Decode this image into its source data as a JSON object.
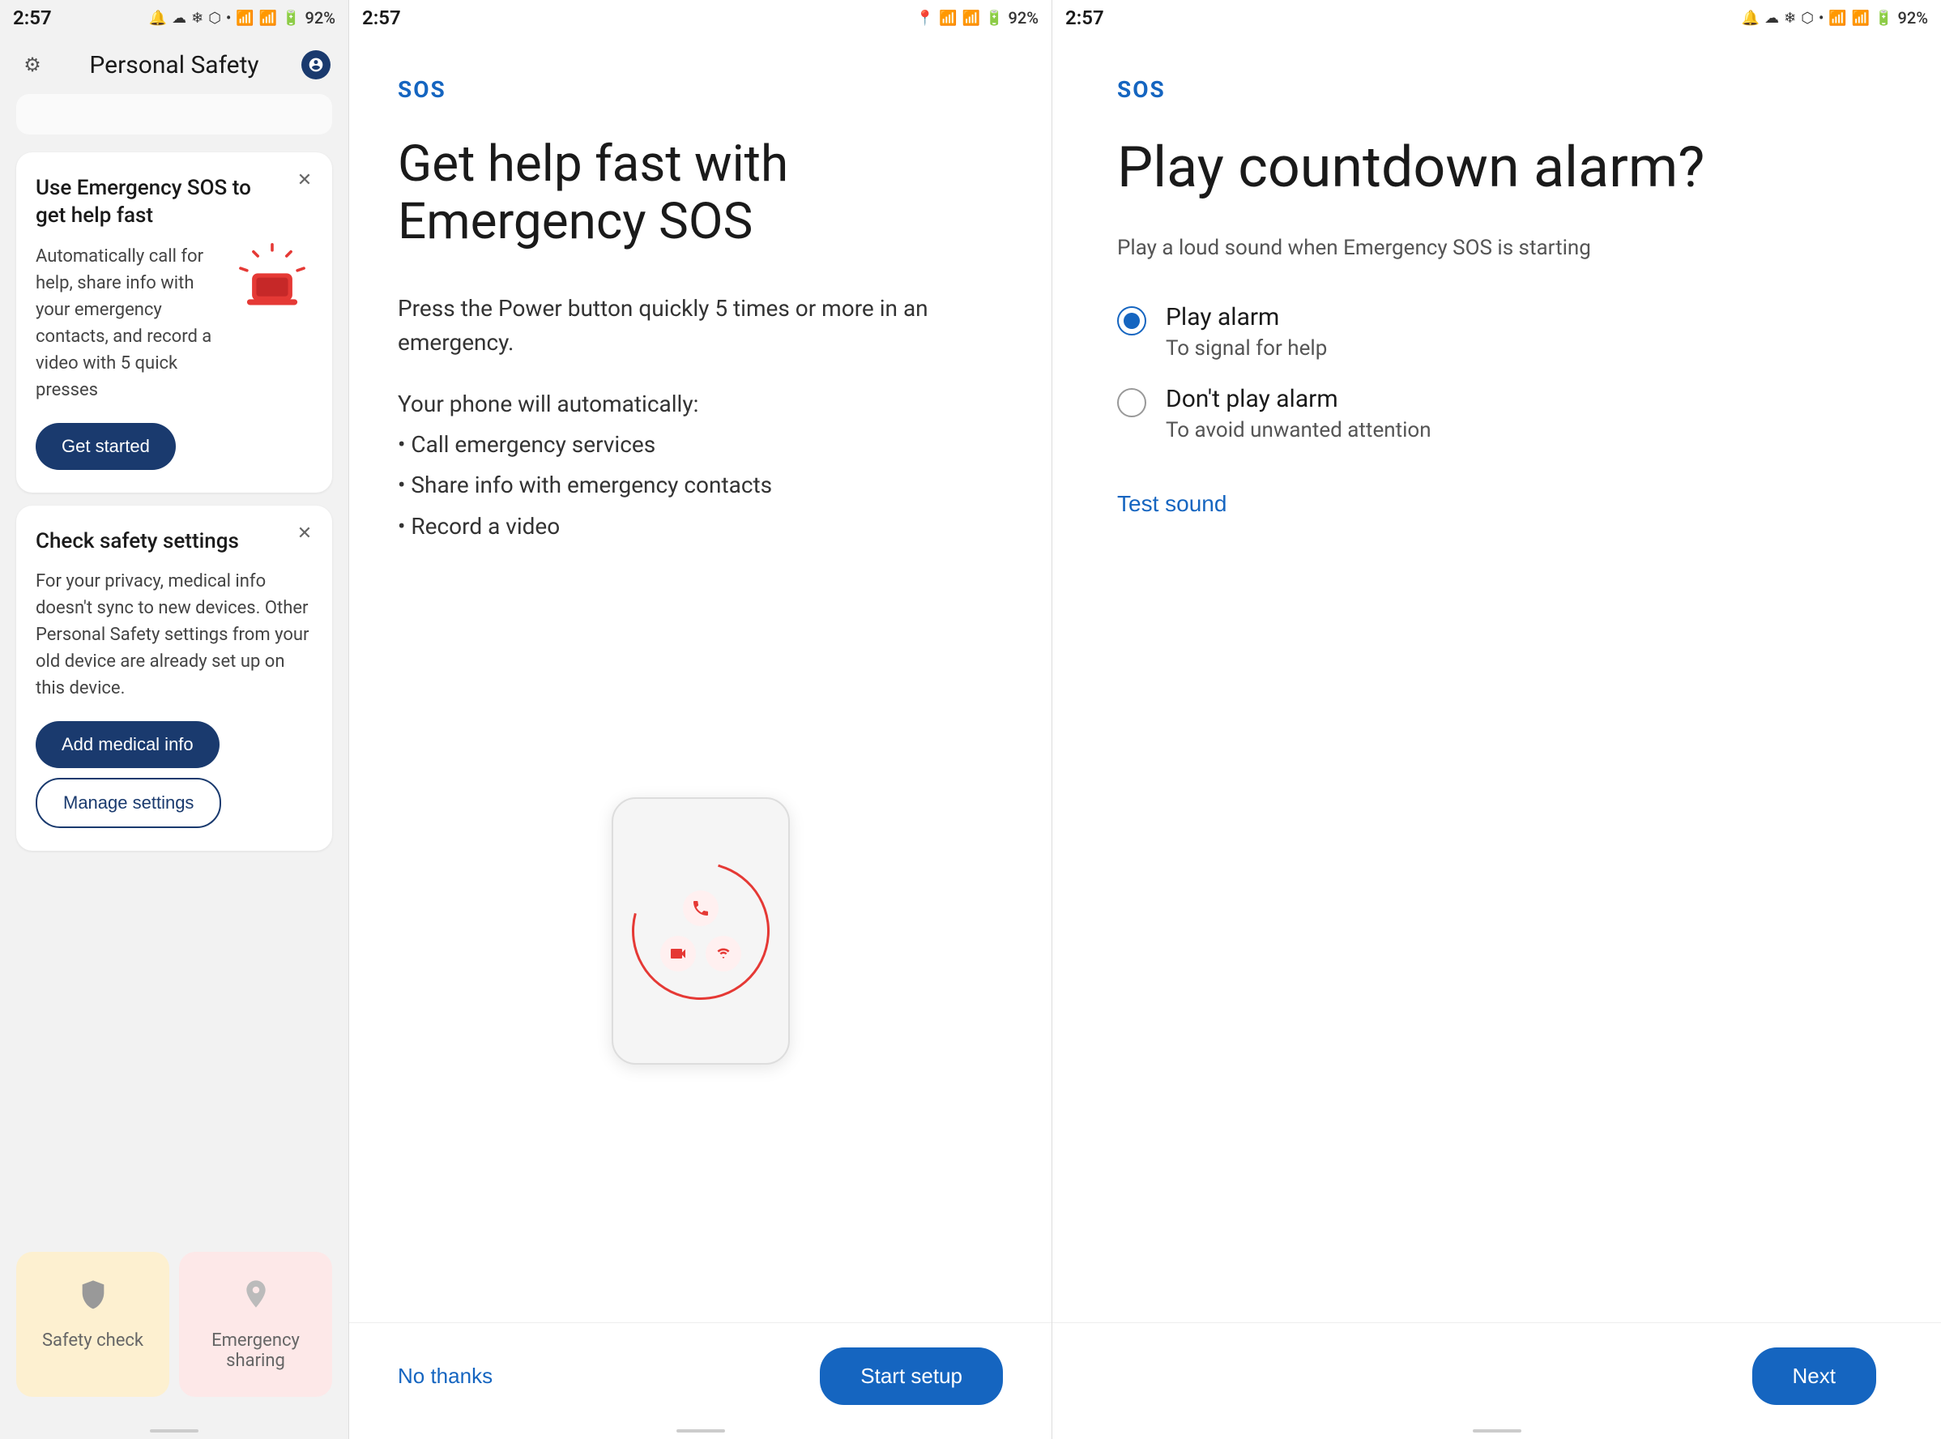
{
  "panel1": {
    "statusBar": {
      "time": "2:57",
      "battery": "92%"
    },
    "appBar": {
      "title": "Personal Safety",
      "settingsLabel": "⚙"
    },
    "card1": {
      "title": "Use Emergency SOS to get help fast",
      "bodyText": "Automatically call for help, share info with your emergency contacts, and record a video with 5 quick presses",
      "buttonLabel": "Get started"
    },
    "card2": {
      "title": "Check safety settings",
      "bodyText": "For your privacy, medical info doesn't sync to new devices. Other Personal Safety settings from your old device are already set up on this device.",
      "btn1Label": "Add medical info",
      "btn2Label": "Manage settings"
    },
    "tiles": {
      "tile1Label": "Safety check",
      "tile2Label": "Emergency sharing"
    }
  },
  "panel2": {
    "statusBar": {
      "time": "2:57",
      "battery": "92%"
    },
    "sosBadge": "SOS",
    "title": "Get help fast with Emergency SOS",
    "subtitle": "Press the Power button quickly 5 times or more in an emergency.",
    "listTitle": "Your phone will automatically:",
    "listItems": [
      "Call emergency services",
      "Share info with emergency contacts",
      "Record a video"
    ],
    "footer": {
      "noThanksLabel": "No thanks",
      "startSetupLabel": "Start setup"
    }
  },
  "panel3": {
    "statusBar": {
      "time": "2:57",
      "battery": "92%"
    },
    "sosBadge": "SOS",
    "title": "Play countdown alarm?",
    "description": "Play a loud sound when Emergency SOS is starting",
    "options": [
      {
        "label": "Play alarm",
        "sublabel": "To signal for help",
        "selected": true
      },
      {
        "label": "Don't play alarm",
        "sublabel": "To avoid unwanted attention",
        "selected": false
      }
    ],
    "testSoundLabel": "Test sound",
    "footer": {
      "nextLabel": "Next"
    }
  }
}
